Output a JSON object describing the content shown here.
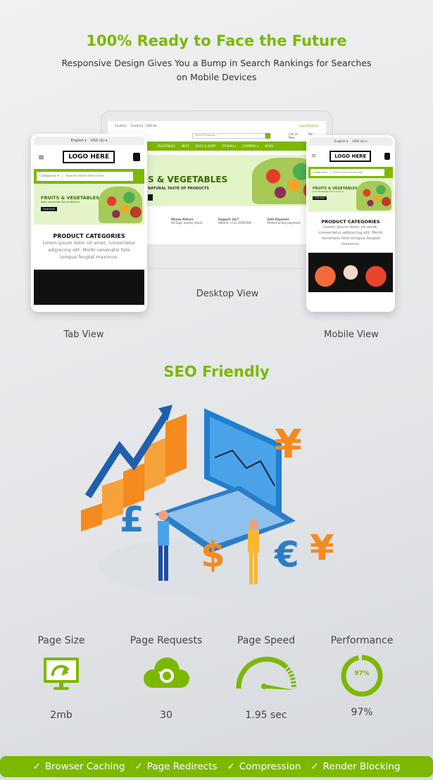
{
  "header": {
    "title": "100% Ready to Face the Future",
    "subtitle": "Responsive Design Gives You a Bump in Search Rankings for Searches on Mobile Devices"
  },
  "desktop": {
    "label": "Desktop View",
    "country": "Country :",
    "currency": "Currency : USD ($)",
    "login": "Login/Register",
    "search_placeholder": "Search Products...",
    "call": "Call Us Now",
    "phone": "+12 3456789",
    "cart": "My Cart",
    "nav": [
      "VEGETABLES",
      "MEAT",
      "EGGS & DAIRY",
      "OTHERS ▾",
      "COMPANY ▾",
      "NEWS"
    ],
    "banner_title": "S & VEGETABLES",
    "banner_sub": "NATURAL TASTE OF PRODUCTS",
    "features": [
      {
        "title": "Money Return",
        "text": "30 Days money return"
      },
      {
        "title": "Support 24/7",
        "text": "Hotline: (+12 3456789)"
      },
      {
        "title": "Safe Payment",
        "text": "Protect online payment"
      }
    ]
  },
  "tab": {
    "label": "Tab View",
    "language": "English ▾",
    "currency": "USD ($) ▾",
    "logo": "LOGO HERE",
    "categories": "Categories ▾",
    "search_placeholder": "Search entire store here",
    "banner_title": "FRUITS & VEGETABLES",
    "banner_sub": "EXOTIC AND NATURAL TASTE OF PRODUCTS",
    "shop_now": "SHOP NOW",
    "section_title": "PRODUCT CATEGORIES",
    "section_text": "Lorem ipsum dolor sit amet, consectetur adipiscing elit. Morbi venenatis felis tempus feugiat maximus."
  },
  "mobile": {
    "label": "Mobile View",
    "language": "English ▾",
    "currency": "USD ($) ▾",
    "logo": "LOGO HERE",
    "categories": "Categories ▾",
    "search_placeholder": "Search entire store here",
    "banner_title": "FRUITS & VEGETABLES",
    "banner_sub": "EXOTIC AND NATURAL TASTE OF PRODUCTS",
    "shop_now": "SHOP NOW",
    "section_title": "PRODUCT CATEGORIES",
    "section_text": "Lorem ipsum dolor sit amet, consectetur adipiscing elit. Morbi venenatis felis tempus feugiat maximus."
  },
  "seo": {
    "title": "SEO Friendly"
  },
  "stats": [
    {
      "label": "Page Size",
      "value": "2mb",
      "icon": "monitor-gauge-icon"
    },
    {
      "label": "Page Requests",
      "value": "30",
      "icon": "cloud-refresh-icon"
    },
    {
      "label": "Page Speed",
      "value": "1.95 sec",
      "icon": "speedometer-icon"
    },
    {
      "label": "Performance",
      "value": "97%",
      "icon": "progress-ring-icon",
      "ring_text": "97%",
      "percent": 97
    }
  ],
  "features_bar": [
    "Browser Caching",
    "Page Redirects",
    "Compression",
    "Render Blocking"
  ],
  "colors": {
    "accent": "#7cb800"
  }
}
